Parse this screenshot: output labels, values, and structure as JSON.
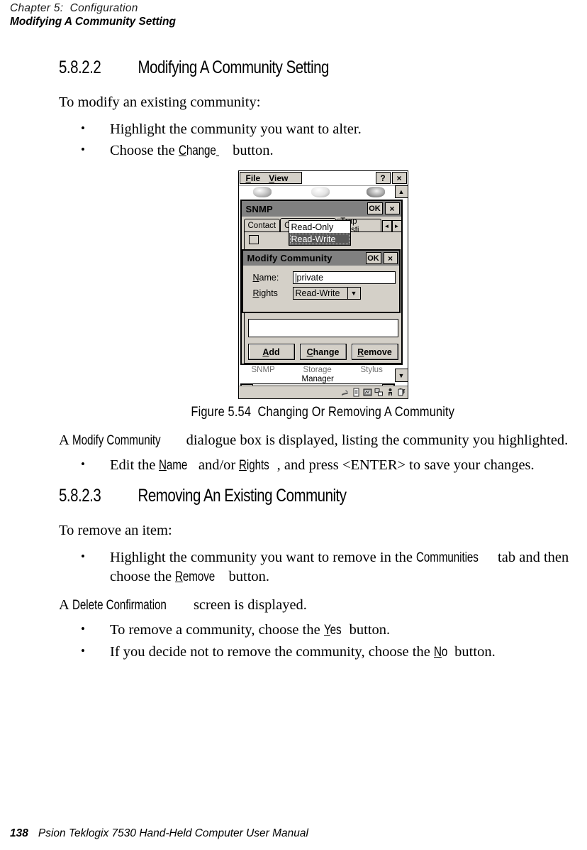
{
  "header": {
    "chapter": "Chapter 5:  Configuration",
    "title": "Modifying A Community Setting"
  },
  "sections": [
    {
      "number": "5.8.2.2",
      "heading": "Modifying A Community Setting",
      "intro": "To modify an existing community:",
      "bullets": [
        "Highlight the community you want to alter.",
        "Choose the Change button."
      ]
    },
    {
      "number": "5.8.2.3",
      "heading": "Removing An Existing Community",
      "intro": "To remove an item:",
      "bullets": [
        "Highlight the community you want to remove in the Communities tab and then choose the Remove button.",
        "To remove a community, choose the Yes button.",
        "If you decide not to remove the community, choose the No button."
      ]
    }
  ],
  "body_text": {
    "bullet1_b": "Highlight the community you want to alter.",
    "bullet2_pre": "Choose the ",
    "bullet2_ui_first": "C",
    "bullet2_ui_rest": "hange",
    "bullet2_post": " button.",
    "after_figure_pre": "A ",
    "after_figure_ui": "Modify Community",
    "after_figure_post": " dialogue box is displayed, listing the community you highlighted.",
    "edit_pre": "Edit the ",
    "edit_ui1_first": "N",
    "edit_ui1_rest": "ame",
    "edit_mid": " and/or ",
    "edit_ui2_first": "R",
    "edit_ui2_rest": "ights",
    "edit_post": ", and press <ENTER> to save your changes.",
    "remove_bullet_pre": "Highlight the community you want to remove in the ",
    "remove_bullet_ui": "Communities",
    "remove_bullet_mid": " tab and then choose the ",
    "remove_bullet_ui2_first": "R",
    "remove_bullet_ui2_rest": "emove",
    "remove_bullet_post": " button.",
    "delete_pre": "A ",
    "delete_ui": "Delete Confirmation",
    "delete_post": " screen is displayed.",
    "yes_pre": "To remove a community, choose the ",
    "yes_ui_first": "Y",
    "yes_ui_rest": "es",
    "yes_post": " button.",
    "no_pre": "If you decide not to remove the community, choose the ",
    "no_ui_first": "N",
    "no_ui_rest": "o",
    "no_post": " button."
  },
  "figure": {
    "caption": "Figure 5.54  Changing Or Removing A Community"
  },
  "screenshot": {
    "menubar": {
      "file_u": "F",
      "file_rest": "ile",
      "view_u": "V",
      "view_rest": "iew",
      "help_label": "?",
      "close_label": "×"
    },
    "snmp_window": {
      "title": "SNMP",
      "ok_label": "OK",
      "close_label": "×",
      "tabs": [
        {
          "label": "Contact",
          "active": false
        },
        {
          "label": "Communities",
          "active": true
        },
        {
          "label": "Trap Desti",
          "active": false
        }
      ],
      "tab_prev": "◄",
      "tab_next": "►",
      "buttons": [
        {
          "u": "A",
          "rest": "dd"
        },
        {
          "u": "C",
          "rest": "hange"
        },
        {
          "u": "R",
          "rest": "emove"
        }
      ]
    },
    "modify_dialog": {
      "title": "Modify Community",
      "ok_label": "OK",
      "close_label": "×",
      "name_label_u": "N",
      "name_label_rest": "ame:",
      "name_value": "private",
      "rights_label_u": "R",
      "rights_label_rest": "ights",
      "rights_value": "Read-Write",
      "dropdown_arrow": "▼",
      "dropdown_options": [
        {
          "label": "Read-Only",
          "selected": false
        },
        {
          "label": "Read-Write",
          "selected": true
        }
      ]
    },
    "desktop_labels": {
      "snmp": "SNMP",
      "storage": "Storage",
      "storage2": "Manager",
      "stylus": "Stylus"
    },
    "scrollbars": {
      "up": "▲",
      "down": "▼",
      "left": "◄",
      "right": "►"
    },
    "taskbar_icons": [
      "hand-stylus-icon",
      "document-icon",
      "network-icon",
      "connection-icon",
      "person-icon",
      "battery-icon"
    ]
  },
  "footer": {
    "page_number": "138",
    "manual_title": "Psion Teklogix 7530 Hand-Held Computer User Manual"
  }
}
